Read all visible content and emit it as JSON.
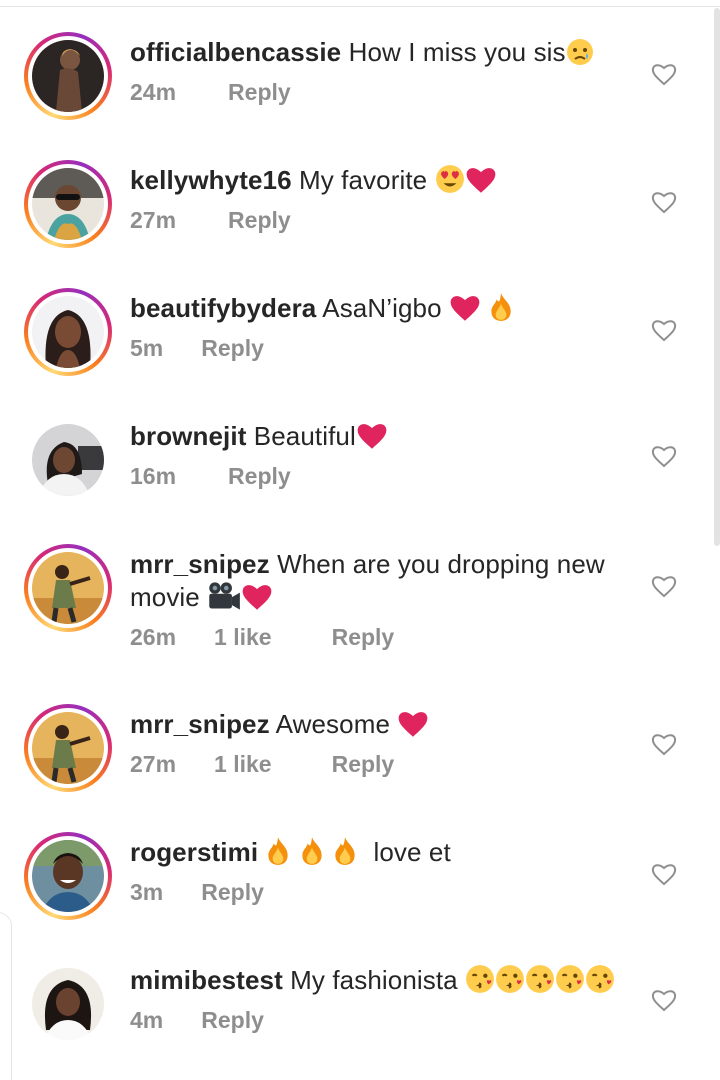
{
  "comments": [
    {
      "username": "officialbencassie",
      "text": "How I miss you sis",
      "emoji": [
        "sad-tear-face"
      ],
      "time": "24m",
      "likes": "",
      "reply": "Reply",
      "ring": true
    },
    {
      "username": "kellywhyte16",
      "text": "My favorite",
      "emoji": [
        "heart-eyes-face",
        "red-heart"
      ],
      "time": "27m",
      "likes": "",
      "reply": "Reply",
      "ring": true
    },
    {
      "username": "beautifybydera",
      "text": "AsaN’igbo",
      "emoji": [
        "red-heart",
        "fire"
      ],
      "time": "5m",
      "likes": "",
      "reply": "Reply",
      "ring": true
    },
    {
      "username": "brownejit",
      "text": "Beautiful",
      "emoji": [
        "red-heart"
      ],
      "time": "16m",
      "likes": "",
      "reply": "Reply",
      "ring": false
    },
    {
      "username": "mrr_snipez",
      "text": "When are you dropping new movie",
      "emoji": [
        "movie-camera",
        "red-heart"
      ],
      "time": "26m",
      "likes": "1 like",
      "reply": "Reply",
      "ring": true
    },
    {
      "username": "mrr_snipez",
      "text": "Awesome",
      "emoji": [
        "red-heart"
      ],
      "time": "27m",
      "likes": "1 like",
      "reply": "Reply",
      "ring": true
    },
    {
      "username": "rogerstimi",
      "text": "love et",
      "emoji": [
        "fire",
        "fire",
        "fire"
      ],
      "time": "3m",
      "likes": "",
      "reply": "Reply",
      "ring": true
    },
    {
      "username": "mimibestest",
      "text": "My fashionista",
      "emoji": [
        "kiss-face",
        "kiss-face",
        "kiss-face",
        "kiss-face",
        "kiss-face"
      ],
      "time": "4m",
      "likes": "",
      "reply": "Reply",
      "ring": false
    }
  ],
  "icons": {
    "like": "heart-outline-icon"
  },
  "colors": {
    "text": "#262626",
    "meta": "#8e8e8e",
    "heart": "#e0245e",
    "fire": "#ff7a00"
  }
}
